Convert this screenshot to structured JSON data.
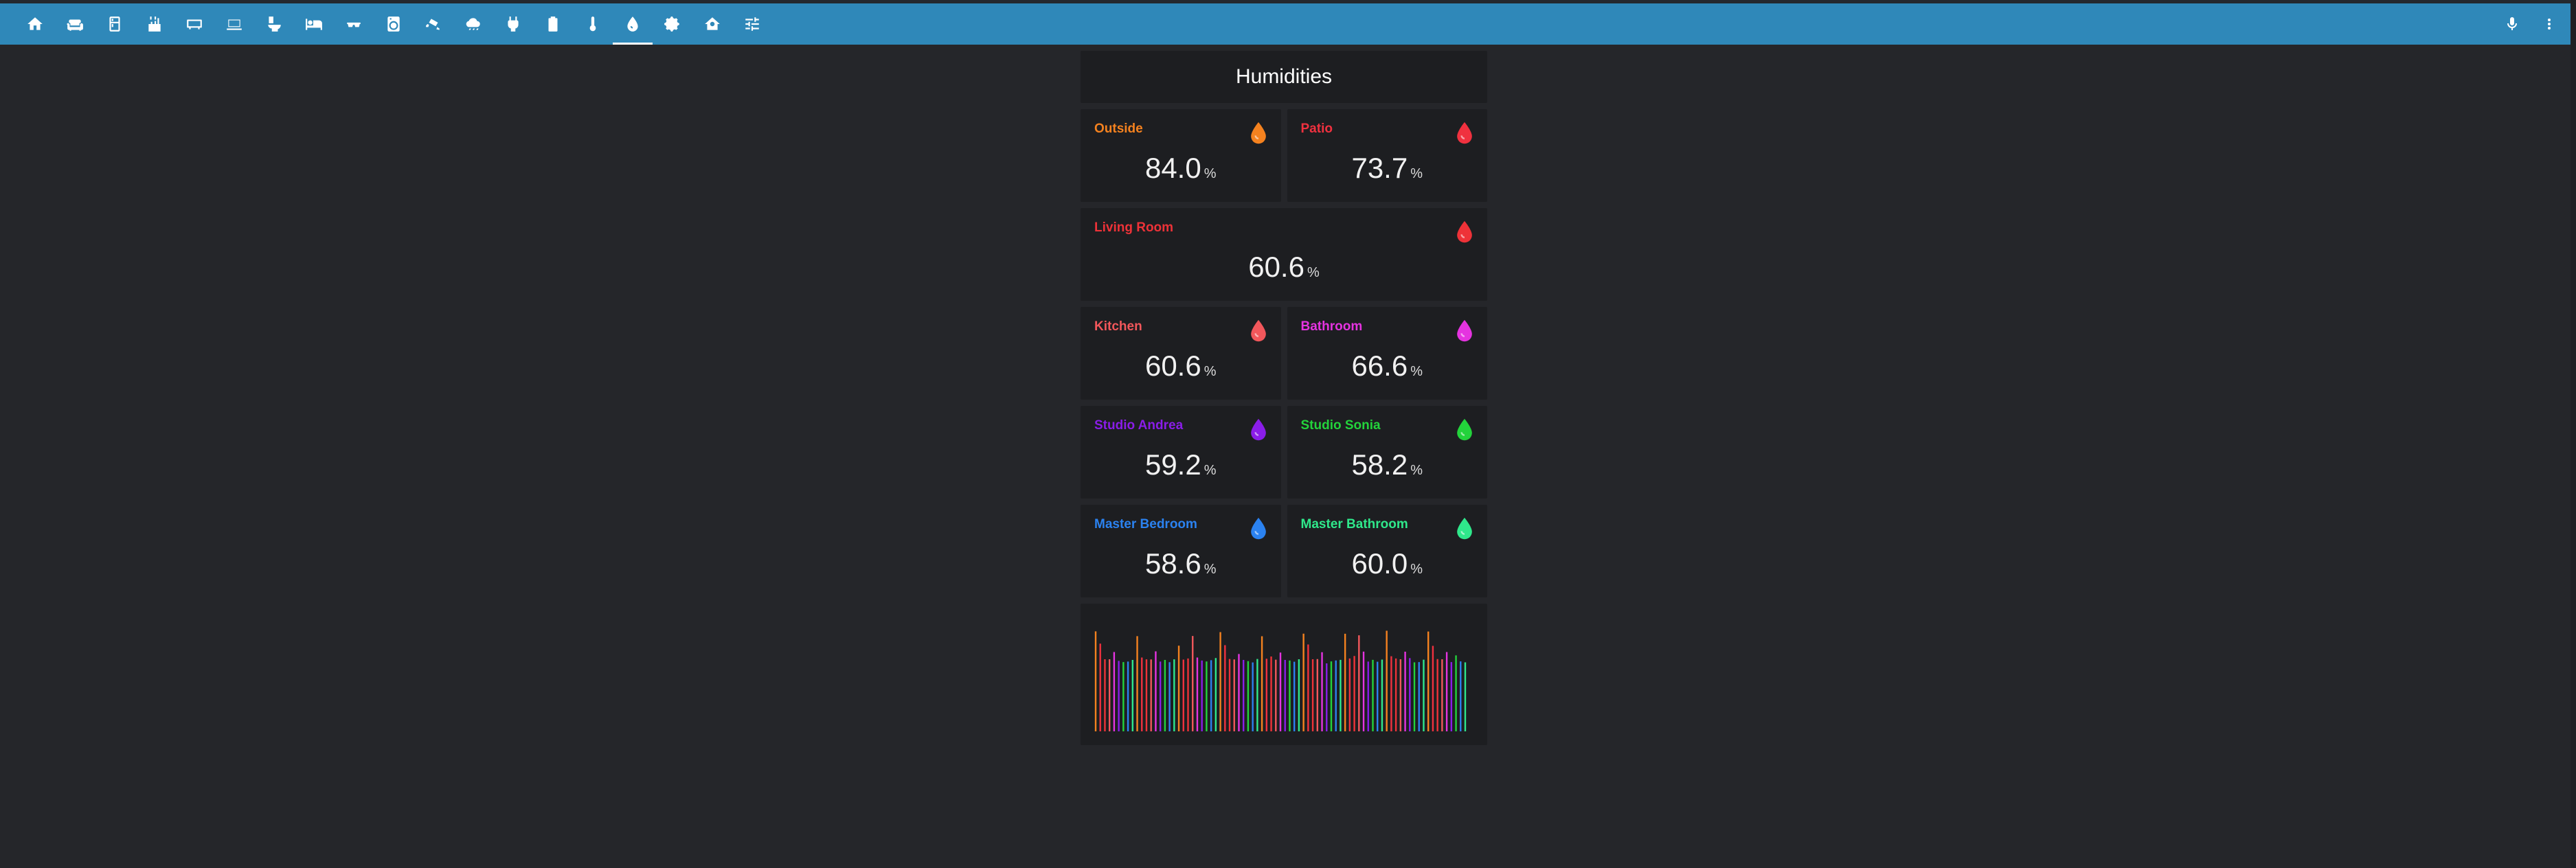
{
  "toolbar": {
    "tabs": [
      {
        "icon": "home-icon"
      },
      {
        "icon": "sofa-icon"
      },
      {
        "icon": "fridge-icon"
      },
      {
        "icon": "kitchen-icon"
      },
      {
        "icon": "tv-icon"
      },
      {
        "icon": "laptop-icon"
      },
      {
        "icon": "toilet-icon"
      },
      {
        "icon": "bed-icon"
      },
      {
        "icon": "glasses-icon"
      },
      {
        "icon": "washing-machine-icon"
      },
      {
        "icon": "cctv-icon"
      },
      {
        "icon": "weather-icon"
      },
      {
        "icon": "power-plug-icon"
      },
      {
        "icon": "battery-icon"
      },
      {
        "icon": "thermometer-icon"
      },
      {
        "icon": "water-drop-icon",
        "active": true
      },
      {
        "icon": "settings-icon"
      },
      {
        "icon": "home-automation-icon"
      },
      {
        "icon": "tune-icon"
      }
    ],
    "right": [
      {
        "icon": "microphone-icon"
      },
      {
        "icon": "more-vertical-icon"
      }
    ]
  },
  "card": {
    "title": "Humidities",
    "unit": "%"
  },
  "sensors": [
    {
      "name": "Outside",
      "value": "84.0",
      "color": "#f5821f"
    },
    {
      "name": "Patio",
      "value": "73.7",
      "color": "#f0313f"
    },
    {
      "name": "Living Room",
      "value": "60.6",
      "color": "#ee3238"
    },
    {
      "name": "Kitchen",
      "value": "60.6",
      "color": "#f2575b"
    },
    {
      "name": "Bathroom",
      "value": "66.6",
      "color": "#e533e0"
    },
    {
      "name": "Studio Andrea",
      "value": "59.2",
      "color": "#8a1de8"
    },
    {
      "name": "Studio Sonia",
      "value": "58.2",
      "color": "#23d33b"
    },
    {
      "name": "Master Bedroom",
      "value": "58.6",
      "color": "#2b82f0"
    },
    {
      "name": "Master Bathroom",
      "value": "60.0",
      "color": "#2fe88b"
    }
  ],
  "chart_data": {
    "type": "bar",
    "series_colors": [
      "#f5821f",
      "#f0313f",
      "#ee3238",
      "#f2575b",
      "#e533e0",
      "#8a1de8",
      "#23d33b",
      "#2b82f0",
      "#2fe88b"
    ],
    "values": [
      84.0,
      73.7,
      60.6,
      60.6,
      66.6,
      59.2,
      58.2,
      58.6,
      60.0,
      80.0,
      62.0,
      60.5,
      60.4,
      67.2,
      58.6,
      60.0,
      58.1,
      60.5,
      72.0,
      60.3,
      61.2,
      80.1,
      62.0,
      59.5,
      58.7,
      59.8,
      61.6,
      83.4,
      72.4,
      60.8,
      60.4,
      65.0,
      60.0,
      59.0,
      57.9,
      60.8,
      79.9,
      61.0,
      62.9,
      60.2,
      66.2,
      60.0,
      59.5,
      58.5,
      60.6,
      82.1,
      73.0,
      60.6,
      60.7,
      66.5,
      57.1,
      58.8,
      59.6,
      60.1,
      82.0,
      61.2,
      63.3,
      80.7,
      67.0,
      58.6,
      60.1,
      58.5,
      60.3,
      84.5,
      63.1,
      61.2,
      60.6,
      66.9,
      61.5,
      58.0,
      58.2,
      60.2,
      83.9,
      71.8,
      60.7,
      60.6,
      66.6,
      58.2,
      63.8,
      58.8,
      58.0
    ],
    "ylim": [
      0,
      90
    ]
  }
}
